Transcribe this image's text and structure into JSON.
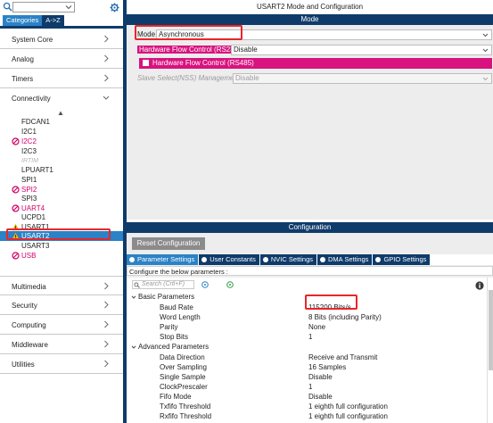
{
  "left_panel": {
    "tabs": [
      "Categories",
      "A->Z"
    ],
    "categories_top": [
      "System Core",
      "Analog",
      "Timers"
    ],
    "connectivity": {
      "label": "Connectivity",
      "items": [
        {
          "label": "FDCAN1",
          "state": "normal"
        },
        {
          "label": "I2C1",
          "state": "normal"
        },
        {
          "label": "I2C2",
          "state": "error"
        },
        {
          "label": "I2C3",
          "state": "normal"
        },
        {
          "label": "IRTIM",
          "state": "disabled"
        },
        {
          "label": "LPUART1",
          "state": "normal"
        },
        {
          "label": "SPI1",
          "state": "normal"
        },
        {
          "label": "SPI2",
          "state": "error"
        },
        {
          "label": "SPI3",
          "state": "normal"
        },
        {
          "label": "UART4",
          "state": "error"
        },
        {
          "label": "UCPD1",
          "state": "normal"
        },
        {
          "label": "USART1",
          "state": "warning"
        },
        {
          "label": "USART2",
          "state": "selected"
        },
        {
          "label": "USART3",
          "state": "normal"
        },
        {
          "label": "USB",
          "state": "error"
        }
      ]
    },
    "categories_bottom": [
      "Multimedia",
      "Security",
      "Computing",
      "Middleware",
      "Utilities"
    ]
  },
  "right_panel": {
    "title": "USART2 Mode and Configuration",
    "mode_header": "Mode",
    "mode": {
      "label": "Mode",
      "value": "Asynchronous"
    },
    "hw_flow_rs232": {
      "label": "Hardware Flow Control (RS232)",
      "value": "Disable"
    },
    "hw_flow_rs485": {
      "label": "Hardware Flow Control (RS485)"
    },
    "slave_select": {
      "label": "Slave Select(NSS) Management",
      "value": "Disable"
    },
    "config_header": "Configuration",
    "reset_button": "Reset Configuration",
    "config_tabs": [
      "Parameter Settings",
      "User Constants",
      "NVIC Settings",
      "DMA Settings",
      "GPIO Settings"
    ],
    "config_hint": "Configure the below parameters :",
    "search_placeholder": "Search (Crtl+F)",
    "groups": [
      {
        "name": "Basic Parameters",
        "params": [
          {
            "name": "Baud Rate",
            "value": "115200 Bits/s"
          },
          {
            "name": "Word Length",
            "value": "8 Bits (including Parity)"
          },
          {
            "name": "Parity",
            "value": "None"
          },
          {
            "name": "Stop Bits",
            "value": "1"
          }
        ]
      },
      {
        "name": "Advanced Parameters",
        "params": [
          {
            "name": "Data Direction",
            "value": "Receive and Transmit"
          },
          {
            "name": "Over Sampling",
            "value": "16 Samples"
          },
          {
            "name": "Single Sample",
            "value": "Disable"
          },
          {
            "name": "ClockPrescaler",
            "value": "1"
          },
          {
            "name": "Fifo Mode",
            "value": "Disable"
          },
          {
            "name": "Txfifo Threshold",
            "value": "1 eighth full configuration"
          },
          {
            "name": "Rxfifo Threshold",
            "value": "1 eighth full configuration"
          }
        ]
      }
    ]
  },
  "colors": {
    "navy": "#0f3b6b",
    "accent_blue": "#2b82c6",
    "magenta": "#d8137f",
    "error_pink": "#d40069",
    "highlight_red": "#e8262a"
  }
}
